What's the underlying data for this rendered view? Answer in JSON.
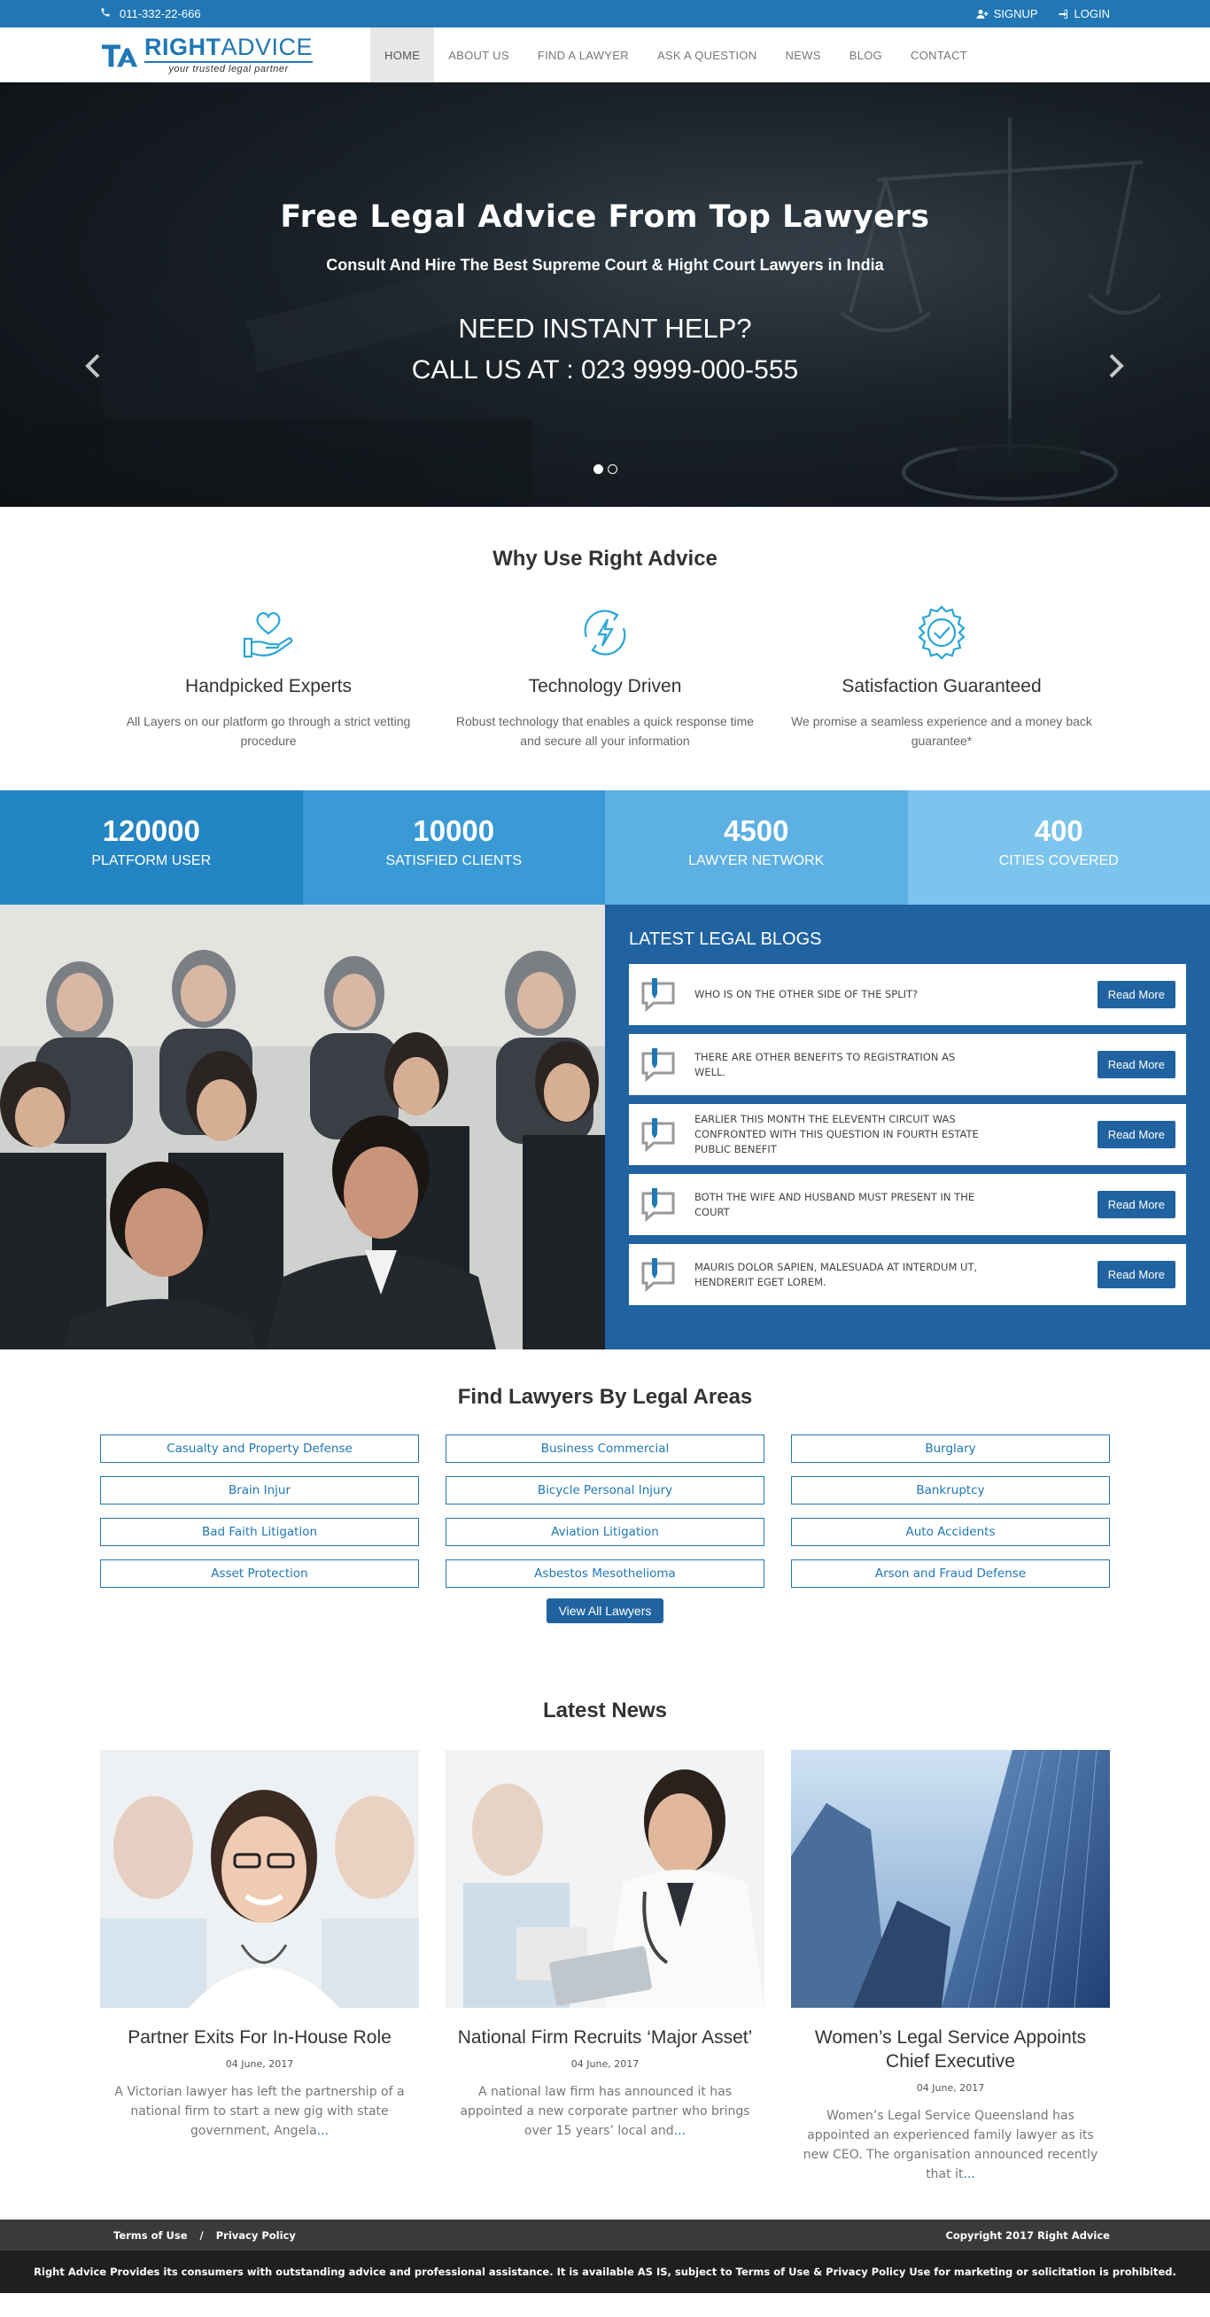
{
  "topbar": {
    "phone": "011-332-22-666",
    "signup": "SIGNUP",
    "login": "LOGIN"
  },
  "logo": {
    "name_bold": "RIGHT",
    "name_light": "ADVICE",
    "tagline": "your trusted legal partner"
  },
  "nav": [
    {
      "label": "HOME",
      "active": true
    },
    {
      "label": "ABOUT US"
    },
    {
      "label": "FIND A LAWYER"
    },
    {
      "label": "ASK A QUESTION"
    },
    {
      "label": "NEWS"
    },
    {
      "label": "BLOG"
    },
    {
      "label": "CONTACT"
    }
  ],
  "hero": {
    "title": "Free Legal Advice From Top Lawyers",
    "subtitle": "Consult And Hire The Best Supreme Court & Hight Court Lawyers in India",
    "need": "NEED INSTANT HELP?",
    "call": "CALL US AT : 023 9999-000-555",
    "prev": "‹",
    "next": "›"
  },
  "why": {
    "title": "Why Use Right Advice",
    "features": [
      {
        "title": "Handpicked Experts",
        "text": "All Layers on our platform go through a strict vetting procedure",
        "icon": "hand-heart-icon"
      },
      {
        "title": "Technology Driven",
        "text": "Robust technology that enables a quick response time and secure all your information",
        "icon": "lightning-cycle-icon"
      },
      {
        "title": "Satisfaction Guaranteed",
        "text": "We promise a seamless experience and a money back guarantee*",
        "icon": "check-badge-icon"
      }
    ]
  },
  "stats": [
    {
      "num": "120000",
      "label": "PLATFORM USER",
      "color": "#2385c4"
    },
    {
      "num": "10000",
      "label": "SATISFIED CLIENTS",
      "color": "#3a9ad6"
    },
    {
      "num": "4500",
      "label": "LAWYER NETWORK",
      "color": "#5db0e4"
    },
    {
      "num": "400",
      "label": "CITIES COVERED",
      "color": "#7bc4ee"
    }
  ],
  "blogs": {
    "title": "LATEST LEGAL BLOGS",
    "read_more": "Read More",
    "items": [
      "WHO IS ON THE OTHER SIDE OF THE SPLIT?",
      "THERE ARE OTHER BENEFITS TO REGISTRATION AS WELL.",
      "EARLIER THIS MONTH THE ELEVENTH CIRCUIT WAS CONFRONTED WITH THIS QUESTION IN FOURTH ESTATE PUBLIC BENEFIT",
      "BOTH THE WIFE AND HUSBAND MUST PRESENT IN THE COURT",
      "MAURIS DOLOR SAPIEN, MALESUADA AT INTERDUM UT, HENDRERIT EGET LOREM."
    ]
  },
  "areas": {
    "title": "Find Lawyers By Legal Areas",
    "items": [
      "Casualty and Property Defense",
      "Business Commercial",
      "Burglary",
      "Brain Injur",
      "Bicycle Personal Injury",
      "Bankruptcy",
      "Bad Faith Litigation",
      "Aviation Litigation",
      "Auto Accidents",
      "Asset Protection",
      "Asbestos Mesothelioma",
      "Arson and Fraud Defense"
    ],
    "view_all": "View All Lawyers"
  },
  "news": {
    "title": "Latest News",
    "items": [
      {
        "title": "Partner Exits For In-House Role",
        "date": "04 June, 2017",
        "text": "A Victorian lawyer has left the partnership of a national firm to start a new gig with state government, Angela",
        "more": "..."
      },
      {
        "title": "National Firm Recruits ‘Major Asset’",
        "date": "04 June, 2017",
        "text": "A national law firm has announced it has appointed a new corporate partner who brings over 15 years’ local and",
        "more": "..."
      },
      {
        "title": "Women’s Legal Service Appoints Chief Executive",
        "date": "04 June, 2017",
        "text": "Women’s Legal Service Queensland has appointed an experienced family lawyer as its new CEO. The organisation announced recently that it",
        "more": "..."
      }
    ]
  },
  "footer": {
    "terms": "Terms of Use",
    "sep": "/",
    "privacy": "Privacy Policy",
    "copyright": "Copyright 2017 Right Advice",
    "disclaimer": "Right Advice Provides its consumers with outstanding advice and professional assistance. It is available AS IS, subject to Terms of Use & Privacy Policy Use for marketing or solicitation is prohibited."
  },
  "colors": {
    "brand": "#2077b4",
    "blog_band": "#2063a0",
    "footer_top": "#3a3a3a",
    "footer_bottom": "#1f1f1f"
  }
}
